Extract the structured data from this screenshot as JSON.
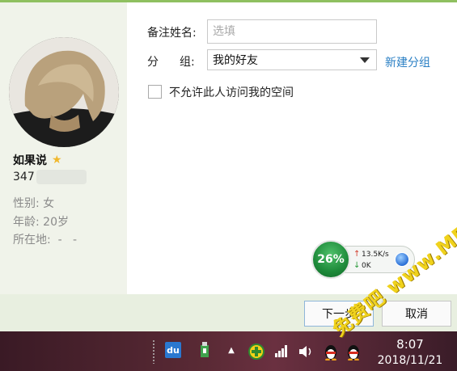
{
  "profile": {
    "name": "如果说",
    "qq_prefix": "347",
    "gender": "性别: 女",
    "age": "年龄: 20岁",
    "location": "所在地:  -   -"
  },
  "form": {
    "remark_label": "备注姓名:",
    "remark_placeholder": "选填",
    "group_label_1": "分",
    "group_label_2": "组:",
    "group_value": "我的好友",
    "new_group_link": "新建分组",
    "privacy_checkbox_label": "不允许此人访问我的空间"
  },
  "footer": {
    "next_label": "下一步",
    "cancel_label": "取消"
  },
  "speed_widget": {
    "percent": "26%",
    "upload": "13.5K/s",
    "download": "0K"
  },
  "taskbar": {
    "time": "8:07",
    "date": "2018/11/21",
    "icons": [
      "baidu-du-icon",
      "usb-drive-icon",
      "chevron-up-icon",
      "plus-security-icon",
      "network-signal-icon",
      "speaker-icon",
      "qq-penguin-icon",
      "qq-penguin-2-icon"
    ]
  },
  "watermark": {
    "text": "免费吧 www.MFsese.com"
  },
  "colors": {
    "accent_green": "#8fc060",
    "link_blue": "#2a7fc4",
    "star_gold": "#f1b82c",
    "sidebar_bg": "#f0f3ea",
    "footer_bg": "#e8efe0"
  }
}
